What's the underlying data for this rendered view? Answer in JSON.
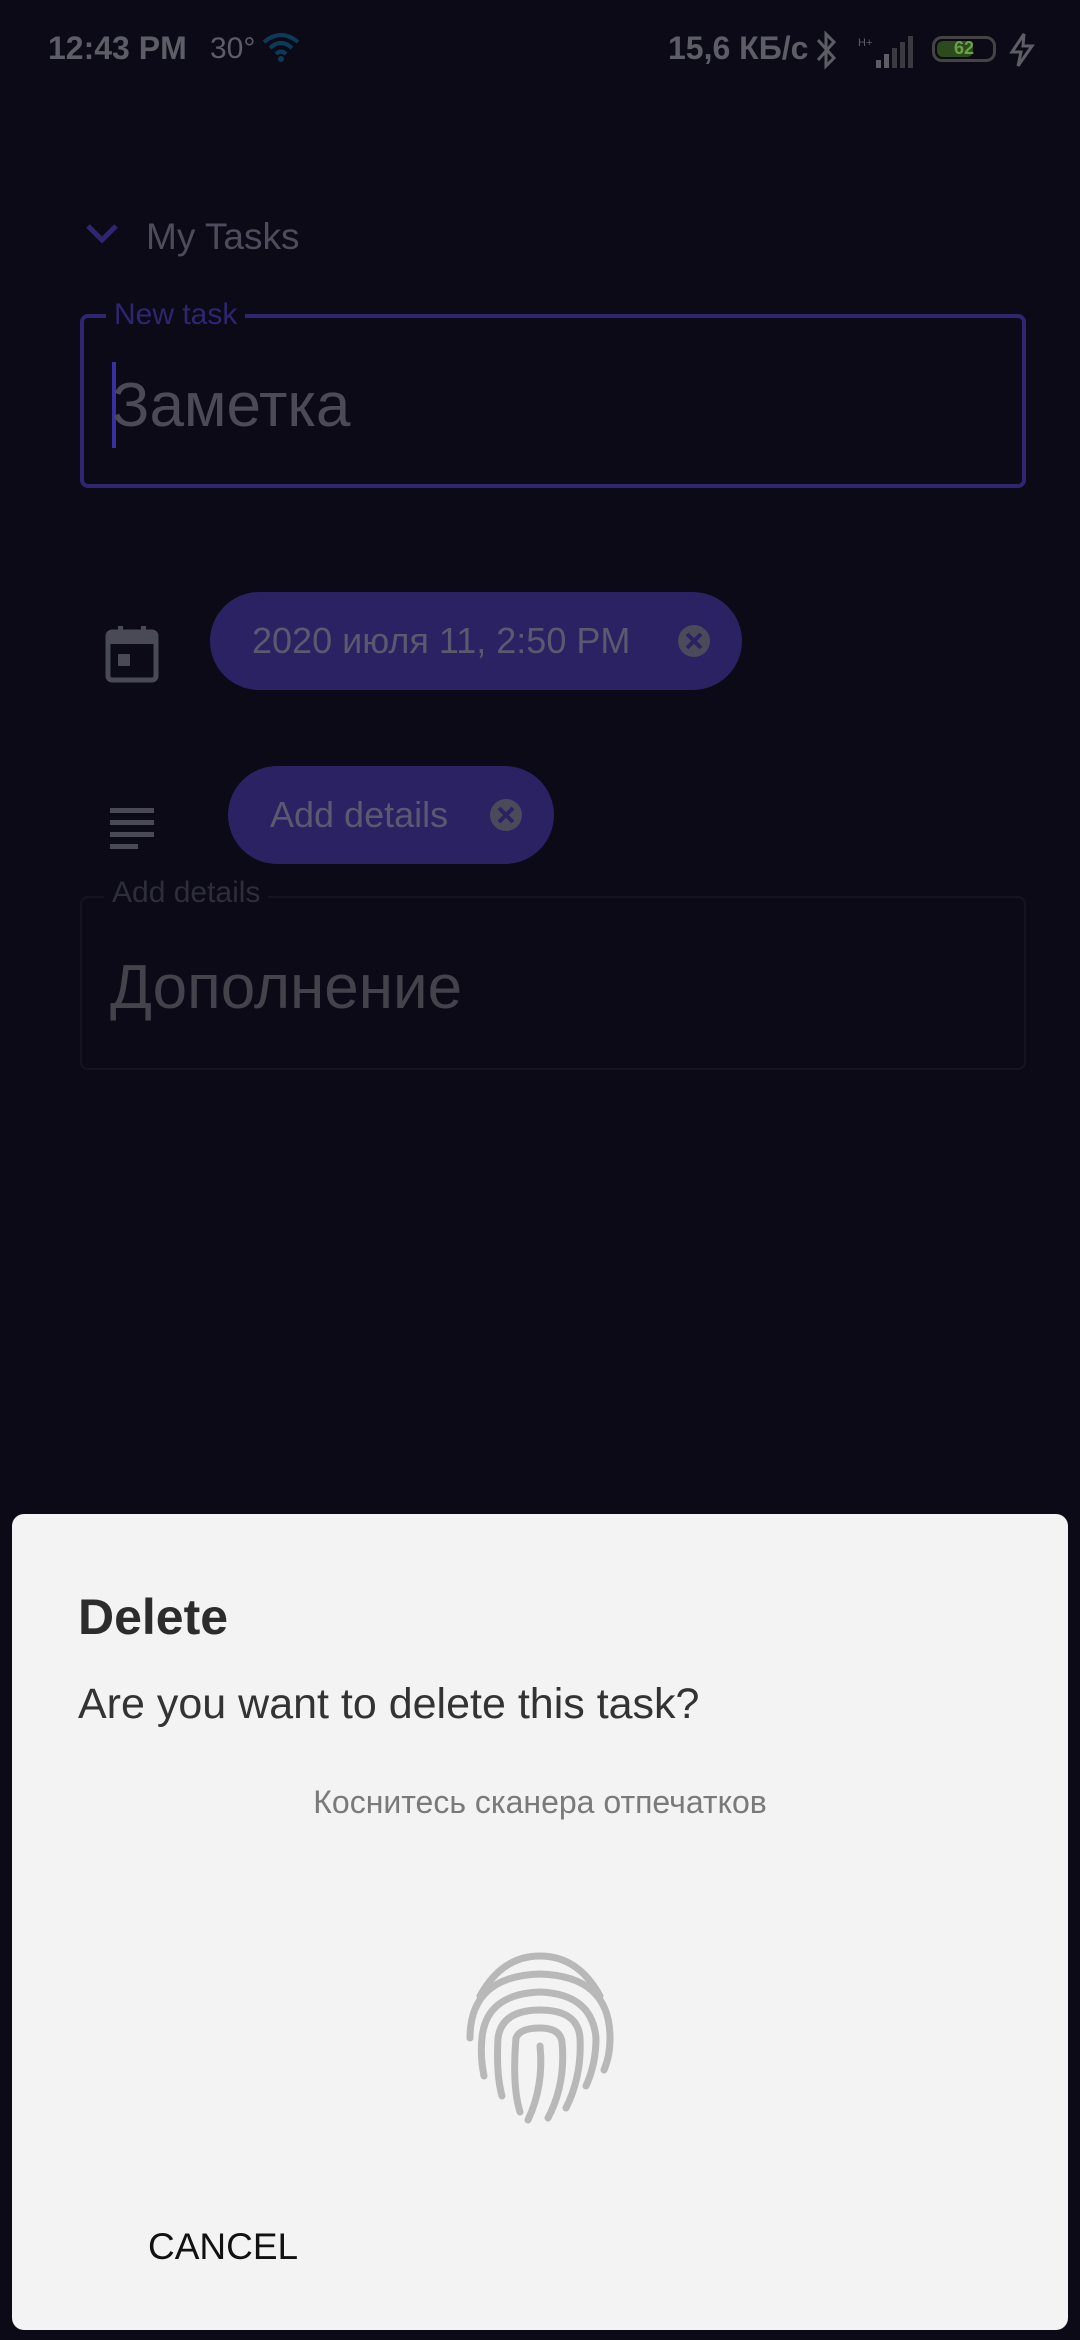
{
  "status_bar": {
    "time": "12:43 PM",
    "temperature": "30°",
    "net_speed": "15,6 КБ/с",
    "battery_level": "62",
    "icons": [
      "wifi-icon",
      "bluetooth-icon",
      "signal-icon",
      "battery-icon",
      "charging-icon"
    ]
  },
  "task": {
    "list_name": "My Tasks",
    "title_label": "New task",
    "title_value": "Заметка",
    "date_chip": "2020 июля 11, 2:50 PM",
    "details_chip": "Add details",
    "details_label": "Add details",
    "details_value": "Дополнение"
  },
  "dialog": {
    "title": "Delete",
    "message": "Are you want to delete this task?",
    "fingerprint_hint": "Коснитесь сканера отпечатков",
    "cancel_label": "CANCEL"
  },
  "colors": {
    "background": "#0b0a16",
    "accent": "#2a2262",
    "dialog_bg": "#f3f3f3"
  }
}
